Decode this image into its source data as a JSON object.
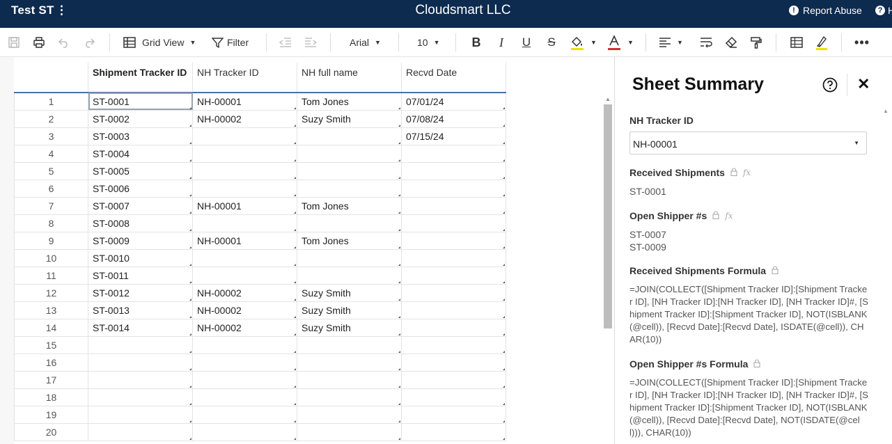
{
  "topbar": {
    "sheet_name": "Test ST",
    "menu_icon": "vertical-ellipsis-icon",
    "company": "Cloudsmart LLC",
    "report_abuse": "Report Abuse",
    "help_label": "H"
  },
  "toolbar": {
    "view": "Grid View",
    "filter": "Filter",
    "font": "Arial",
    "font_size": "10",
    "icons": [
      "save-icon",
      "print-icon",
      "undo-icon",
      "redo-icon",
      "grid-view-icon",
      "filter-icon",
      "outdent-icon",
      "indent-icon",
      "bold-icon",
      "italic-icon",
      "underline-icon",
      "strikethrough-icon",
      "fill-color-icon",
      "text-color-icon",
      "align-icon",
      "wrap-text-icon",
      "clear-format-icon",
      "format-painter-icon",
      "grid-lines-icon",
      "highlight-icon",
      "more-icon"
    ],
    "colors": {
      "fill_underline": "#f0e000",
      "text_underline": "#d42d2d"
    }
  },
  "sheet": {
    "columns": [
      "Shipment Tracker ID",
      "NH Tracker ID",
      "NH full name",
      "Recvd Date"
    ],
    "rows": [
      [
        "1",
        "ST-0001",
        "NH-00001",
        "Tom Jones",
        "07/01/24"
      ],
      [
        "2",
        "ST-0002",
        "NH-00002",
        "Suzy Smith",
        "07/08/24"
      ],
      [
        "3",
        "ST-0003",
        "",
        "",
        "07/15/24"
      ],
      [
        "4",
        "ST-0004",
        "",
        "",
        ""
      ],
      [
        "5",
        "ST-0005",
        "",
        "",
        ""
      ],
      [
        "6",
        "ST-0006",
        "",
        "",
        ""
      ],
      [
        "7",
        "ST-0007",
        "NH-00001",
        "Tom Jones",
        ""
      ],
      [
        "8",
        "ST-0008",
        "",
        "",
        ""
      ],
      [
        "9",
        "ST-0009",
        "NH-00001",
        "Tom Jones",
        ""
      ],
      [
        "10",
        "ST-0010",
        "",
        "",
        ""
      ],
      [
        "11",
        "ST-0011",
        "",
        "",
        ""
      ],
      [
        "12",
        "ST-0012",
        "NH-00002",
        "Suzy Smith",
        ""
      ],
      [
        "13",
        "ST-0013",
        "NH-00002",
        "Suzy Smith",
        ""
      ],
      [
        "14",
        "ST-0014",
        "NH-00002",
        "Suzy Smith",
        ""
      ],
      [
        "15",
        "",
        "",
        "",
        ""
      ],
      [
        "16",
        "",
        "",
        "",
        ""
      ],
      [
        "17",
        "",
        "",
        "",
        ""
      ],
      [
        "18",
        "",
        "",
        "",
        ""
      ],
      [
        "19",
        "",
        "",
        "",
        ""
      ],
      [
        "20",
        "",
        "",
        "",
        ""
      ]
    ]
  },
  "panel": {
    "title": "Sheet Summary",
    "nh_tracker_label": "NH Tracker ID",
    "nh_tracker_value": "NH-00001",
    "received_label": "Received Shipments",
    "received_value": "ST-0001",
    "open_label": "Open Shipper #s",
    "open_values": [
      "ST-0007",
      "ST-0009"
    ],
    "received_formula_label": "Received Shipments Formula",
    "received_formula": "=JOIN(COLLECT([Shipment Tracker ID]:[Shipment Tracker ID], [NH Tracker ID]:[NH Tracker ID], [NH Tracker ID]#, [Shipment Tracker ID]:[Shipment Tracker ID], NOT(ISBLANK(@cell)), [Recvd Date]:[Recvd Date], ISDATE(@cell)), CHAR(10))",
    "open_formula_label": "Open Shipper #s Formula",
    "open_formula": "=JOIN(COLLECT([Shipment Tracker ID]:[Shipment Tracker ID], [NH Tracker ID]:[NH Tracker ID], [NH Tracker ID]#, [Shipment Tracker ID]:[Shipment Tracker ID], NOT(ISBLANK(@cell)), [Recvd Date]:[Recvd Date], NOT(ISDATE(@cell))), CHAR(10))"
  }
}
